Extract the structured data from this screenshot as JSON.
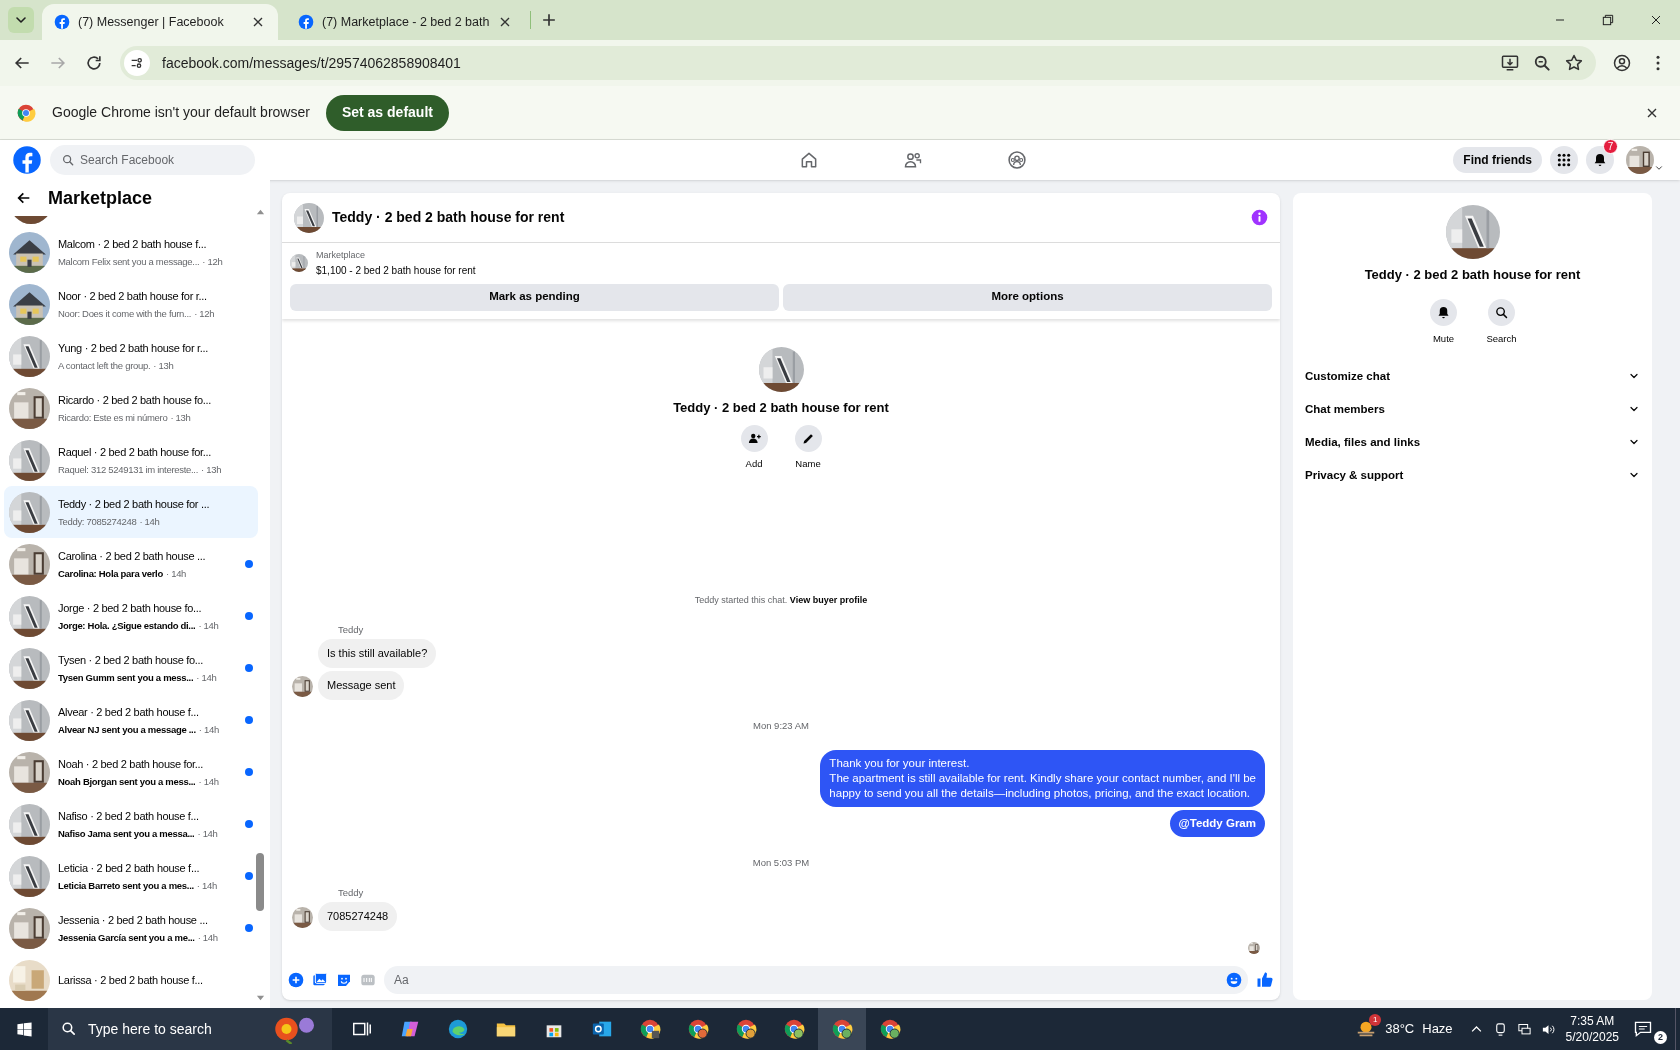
{
  "browser": {
    "tabs": [
      {
        "title": "(7) Messenger | Facebook",
        "selected": true
      },
      {
        "title": "(7) Marketplace - 2 bed 2 bath",
        "selected": false
      }
    ],
    "url": "facebook.com/messages/t/29574062858908401",
    "infobar": {
      "message": "Google Chrome isn't your default browser",
      "button": "Set as default"
    }
  },
  "facebook": {
    "search": {
      "placeholder": "Search Facebook"
    },
    "find_friends": "Find friends",
    "notification_count": "7"
  },
  "sidebar": {
    "title": "Marketplace",
    "conversations": [
      {
        "title": "Malcom · 2 bed 2 bath house f...",
        "preview": "Malcom Felix sent you a message...",
        "time": "· 12h",
        "unread": false,
        "selected": false
      },
      {
        "title": "Noor · 2 bed 2 bath house for r...",
        "preview": "Noor: Does it come with the furn...",
        "time": "· 12h",
        "unread": false,
        "selected": false
      },
      {
        "title": "Yung · 2 bed 2 bath house for r...",
        "preview": "A contact left the group.",
        "time": "· 13h",
        "unread": false,
        "selected": false
      },
      {
        "title": "Ricardo · 2 bed 2 bath house fo...",
        "preview": "Ricardo: Este es mi número",
        "time": "· 13h",
        "unread": false,
        "selected": false
      },
      {
        "title": "Raquel · 2 bed 2 bath house for...",
        "preview": "Raquel: 312 5249131 im intereste...",
        "time": "· 13h",
        "unread": false,
        "selected": false
      },
      {
        "title": "Teddy · 2 bed 2 bath house for ...",
        "preview": "Teddy: 7085274248",
        "time": "· 14h",
        "unread": false,
        "selected": true
      },
      {
        "title": "Carolina · 2 bed 2 bath house ...",
        "preview": "Carolina: Hola para verlo",
        "time": "· 14h",
        "unread": true,
        "selected": false
      },
      {
        "title": "Jorge · 2 bed 2 bath house fo...",
        "preview": "Jorge: Hola. ¿Sigue estando di...",
        "time": "· 14h",
        "unread": true,
        "selected": false
      },
      {
        "title": "Tysen · 2 bed 2 bath house fo...",
        "preview": "Tysen Gumm sent you a mess...",
        "time": "· 14h",
        "unread": true,
        "selected": false
      },
      {
        "title": "Alvear · 2 bed 2 bath house f...",
        "preview": "Alvear NJ sent you a message ...",
        "time": "· 14h",
        "unread": true,
        "selected": false
      },
      {
        "title": "Noah · 2 bed 2 bath house for...",
        "preview": "Noah Bjorgan sent you a mess...",
        "time": "· 14h",
        "unread": true,
        "selected": false
      },
      {
        "title": "Nafiso · 2 bed 2 bath house f...",
        "preview": "Nafiso Jama sent you a messa...",
        "time": "· 14h",
        "unread": true,
        "selected": false
      },
      {
        "title": "Leticia · 2 bed 2 bath house f...",
        "preview": "Leticia Barreto sent you a mes...",
        "time": "· 14h",
        "unread": true,
        "selected": false
      },
      {
        "title": "Jessenia · 2 bed 2 bath house ...",
        "preview": "Jessenia García sent you a me...",
        "time": "· 14h",
        "unread": true,
        "selected": false
      },
      {
        "title": "Larissa · 2 bed 2 bath house f...",
        "selected": false
      }
    ]
  },
  "chat": {
    "title": "Teddy · 2 bed 2 bath house for rent",
    "listing": {
      "label": "Marketplace",
      "title": "$1,100 - 2 bed 2 bath house for rent",
      "buttons": [
        "Mark as pending",
        "More options"
      ]
    },
    "profile": {
      "name": "Teddy · 2 bed 2 bath house for rent",
      "actions": [
        "Add",
        "Name"
      ]
    },
    "messages": [
      {
        "kind": "system",
        "text": "Teddy started this chat.",
        "link": "View buyer profile"
      },
      {
        "kind": "sender",
        "text": "Teddy"
      },
      {
        "kind": "incoming",
        "text": "Is this still available?",
        "avatar": false
      },
      {
        "kind": "incoming",
        "text": "Message sent",
        "avatar": true
      },
      {
        "kind": "time",
        "text": "Mon 9:23 AM"
      },
      {
        "kind": "outgoing",
        "text": "Thank you for your interest.\nThe apartment is still available for rent. Kindly share your contact number, and I'll be\nhappy to send you all the details—including photos, pricing, and the exact location.",
        "bold": false
      },
      {
        "kind": "outgoing",
        "text": "@Teddy Gram",
        "bold": true
      },
      {
        "kind": "time",
        "text": "Mon 5:03 PM"
      },
      {
        "kind": "sender",
        "text": "Teddy"
      },
      {
        "kind": "incoming",
        "text": "7085274248",
        "avatar": true
      }
    ],
    "composer": {
      "placeholder": "Aa"
    }
  },
  "details": {
    "name": "Teddy · 2 bed 2 bath house for rent",
    "actions": [
      "Mute",
      "Search"
    ],
    "sections": [
      {
        "label": "Customize chat",
        "expanded": false
      },
      {
        "label": "Chat members",
        "expanded": false
      },
      {
        "label": "Media, files and links",
        "expanded": false
      },
      {
        "label": "Privacy & support",
        "expanded": false
      }
    ]
  },
  "taskbar": {
    "search": {
      "placeholder": "Type here to search"
    },
    "weather_badge": "1",
    "temperature": "38°C",
    "condition": "Haze",
    "time": "7:35 AM",
    "date": "5/20/2025",
    "notification_count": "2"
  }
}
